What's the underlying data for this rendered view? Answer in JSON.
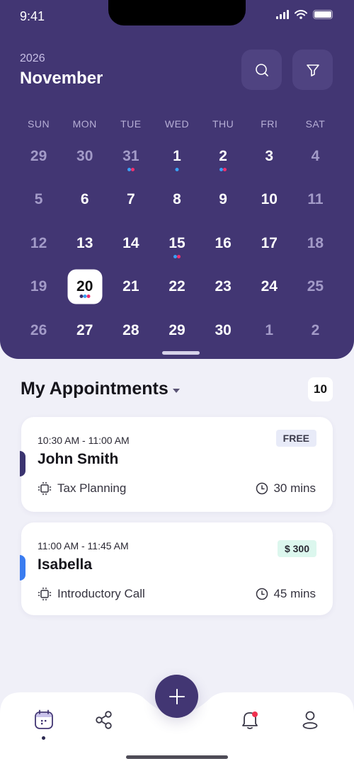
{
  "status_bar": {
    "time": "9:41"
  },
  "header": {
    "year": "2026",
    "month": "November",
    "search_icon": "search-icon",
    "filter_icon": "filter-icon"
  },
  "calendar": {
    "weekdays": [
      "SUN",
      "MON",
      "TUE",
      "WED",
      "THU",
      "FRI",
      "SAT"
    ],
    "selected_day": "20",
    "dot_colors": {
      "blue": "#3aa0f5",
      "pink": "#f0316e",
      "navy": "#3b3470"
    },
    "days": [
      {
        "n": "29",
        "muted": true,
        "dots": []
      },
      {
        "n": "30",
        "muted": true,
        "dots": []
      },
      {
        "n": "31",
        "muted": true,
        "dots": [
          "blue",
          "pink"
        ]
      },
      {
        "n": "1",
        "muted": false,
        "dots": [
          "blue"
        ]
      },
      {
        "n": "2",
        "muted": false,
        "dots": [
          "blue",
          "pink"
        ]
      },
      {
        "n": "3",
        "muted": false,
        "dots": []
      },
      {
        "n": "4",
        "muted": true,
        "dots": []
      },
      {
        "n": "5",
        "muted": true,
        "dots": []
      },
      {
        "n": "6",
        "muted": false,
        "dots": []
      },
      {
        "n": "7",
        "muted": false,
        "dots": []
      },
      {
        "n": "8",
        "muted": false,
        "dots": []
      },
      {
        "n": "9",
        "muted": false,
        "dots": []
      },
      {
        "n": "10",
        "muted": false,
        "dots": []
      },
      {
        "n": "11",
        "muted": true,
        "dots": []
      },
      {
        "n": "12",
        "muted": true,
        "dots": []
      },
      {
        "n": "13",
        "muted": false,
        "dots": []
      },
      {
        "n": "14",
        "muted": false,
        "dots": []
      },
      {
        "n": "15",
        "muted": false,
        "dots": [
          "blue",
          "pink"
        ]
      },
      {
        "n": "16",
        "muted": false,
        "dots": []
      },
      {
        "n": "17",
        "muted": false,
        "dots": []
      },
      {
        "n": "18",
        "muted": true,
        "dots": []
      },
      {
        "n": "19",
        "muted": true,
        "dots": []
      },
      {
        "n": "20",
        "muted": false,
        "selected": true,
        "dots": [
          "navy",
          "blue",
          "pink"
        ]
      },
      {
        "n": "21",
        "muted": false,
        "dots": []
      },
      {
        "n": "22",
        "muted": false,
        "dots": []
      },
      {
        "n": "23",
        "muted": false,
        "dots": []
      },
      {
        "n": "24",
        "muted": false,
        "dots": []
      },
      {
        "n": "25",
        "muted": true,
        "dots": []
      },
      {
        "n": "26",
        "muted": true,
        "dots": []
      },
      {
        "n": "27",
        "muted": false,
        "dots": []
      },
      {
        "n": "28",
        "muted": false,
        "dots": []
      },
      {
        "n": "29",
        "muted": false,
        "dots": []
      },
      {
        "n": "30",
        "muted": false,
        "dots": []
      },
      {
        "n": "1",
        "muted": true,
        "dots": []
      },
      {
        "n": "2",
        "muted": true,
        "dots": []
      }
    ]
  },
  "appointments": {
    "title": "My Appointments",
    "count": "10",
    "items": [
      {
        "time": "10:30 AM - 11:00 AM",
        "name": "John Smith",
        "service": "Tax Planning",
        "duration": "30 mins",
        "price": "FREE",
        "accent": "#3b3470"
      },
      {
        "time": "11:00 AM - 11:45 AM",
        "name": "Isabella",
        "service": "Introductory Call",
        "duration": "45 mins",
        "price": "$ 300",
        "accent": "#3a7cf0"
      }
    ]
  },
  "tabbar": {
    "tabs": [
      "calendar-tab",
      "share-tab",
      "notifications-tab",
      "profile-tab"
    ],
    "active": "calendar-tab",
    "notification_badge_color": "#f0314f"
  },
  "colors": {
    "primary": "#423673",
    "background": "#f0f0f8"
  }
}
